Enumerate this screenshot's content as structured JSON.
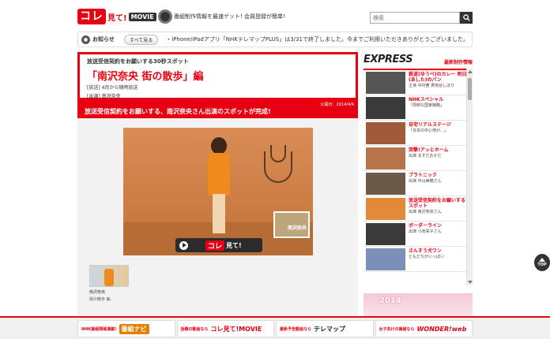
{
  "header": {
    "logo_kore": "コレ",
    "logo_miteru": "見て!",
    "logo_movie": "MOVIE",
    "tagline": "番組制作情報を最速ゲット! 会員登録が簡単!",
    "search_placeholder": "検索"
  },
  "notice": {
    "label": "お知らせ",
    "all_button": "すべて見る",
    "text": "・iPhone/iPadアプリ「NHKテレマップPLUS」は3/31で終了しました。今までご利用いただきありがとうございました。"
  },
  "article": {
    "kicker": "放送受信契約をお願いする30秒スポット",
    "title": "「南沢奈央 街の散歩」編",
    "meta_broadcast": "[放送] 4月から随時放送",
    "meta_cast": "[出演] 南沢奈央",
    "date": "公開日：2014/4/4",
    "headline": "放送受信契約をお願いする、南沢奈央さん出演のスポットが完成!",
    "video_photo_label": "南沢奈央",
    "video_caption_kore": "コレ",
    "video_caption_rest": "見て!",
    "thumb_name": "南沢奈央",
    "thumb_sub": "街の散歩 編"
  },
  "sidebar": {
    "logo": "EXPRESS",
    "sub": "最新制作情報",
    "items": [
      {
        "title": "鉄道(ゆうべ)のカレー 明日(あした)のパン",
        "sub": "主演 中村蒼 貫地谷しほり",
        "color": "#555555"
      },
      {
        "title": "NHKスペシャル",
        "sub": "「周到な国家戦略」",
        "color": "#3a3a3a"
      },
      {
        "title": "自宅リアルステージ",
        "sub": "「日本の中心地が…」",
        "color": "#a05c3a"
      },
      {
        "title": "突撃!アッとホーム",
        "sub": "出演 ますだおかだ",
        "color": "#b8734a"
      },
      {
        "title": "ブラトニック",
        "sub": "出演 中山美穂さん",
        "color": "#6b5a4a"
      },
      {
        "title": "放送受信契約をお願いするスポット",
        "sub": "出演 南沢奈央さん",
        "color": "#e08a3a"
      },
      {
        "title": "ボーダーライン",
        "sub": "出演 小池栄子さん",
        "color": "#3a3a3a"
      },
      {
        "title": "さんすう犬ワン",
        "sub": "ともだちがいっぱい",
        "color": "#7a90b8"
      }
    ],
    "banner_year": "2014"
  },
  "top_button": "TOP",
  "footer": [
    {
      "label": "NHK番組情報満載!",
      "brand": "番組ナビ"
    },
    {
      "label": "話題の動画なら",
      "brand": "コレ見て!MOVIE"
    },
    {
      "label": "最新予告動画なら",
      "brand": "テレマップ"
    },
    {
      "label": "女子向けの番組なら",
      "brand": "WONDER!web"
    }
  ]
}
